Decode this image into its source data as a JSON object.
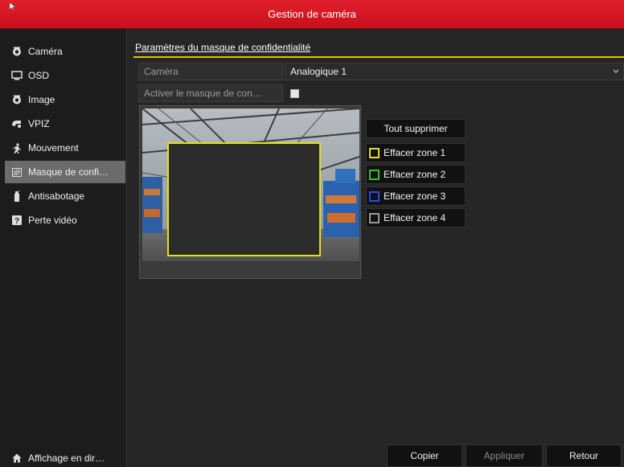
{
  "window": {
    "title": "Gestion de caméra"
  },
  "sidebar": {
    "items": [
      {
        "label": "Caméra",
        "icon": "camera-icon"
      },
      {
        "label": "OSD",
        "icon": "monitor-icon"
      },
      {
        "label": "Image",
        "icon": "image-icon"
      },
      {
        "label": "VPIZ",
        "icon": "ptz-icon"
      },
      {
        "label": "Mouvement",
        "icon": "motion-icon"
      },
      {
        "label": "Masque de confi…",
        "icon": "privacy-mask-icon",
        "active": true
      },
      {
        "label": "Antisabotage",
        "icon": "tamper-icon"
      },
      {
        "label": "Perte vidéo",
        "icon": "video-loss-icon"
      }
    ],
    "live_view": {
      "label": "Affichage en dir…",
      "icon": "home-icon"
    }
  },
  "main": {
    "section_title": "Paramètres du masque de confidentialité",
    "camera_label": "Caméra",
    "camera_value": "Analogique 1",
    "enable_label": "Activer le masque de con…",
    "enable_checked": true,
    "clear_all": "Tout supprimer",
    "zones": [
      {
        "label": "Effacer zone 1",
        "color": "#e5e01a"
      },
      {
        "label": "Effacer zone 2",
        "color": "#2ec42e"
      },
      {
        "label": "Effacer zone 3",
        "color": "#2a4bf0"
      },
      {
        "label": "Effacer zone 4",
        "color": "#9a9a9a"
      }
    ]
  },
  "footer": {
    "copy": "Copier",
    "apply": "Appliquer",
    "back": "Retour"
  },
  "colors": {
    "accent": "#d0141f",
    "highlight": "#e6c200"
  }
}
